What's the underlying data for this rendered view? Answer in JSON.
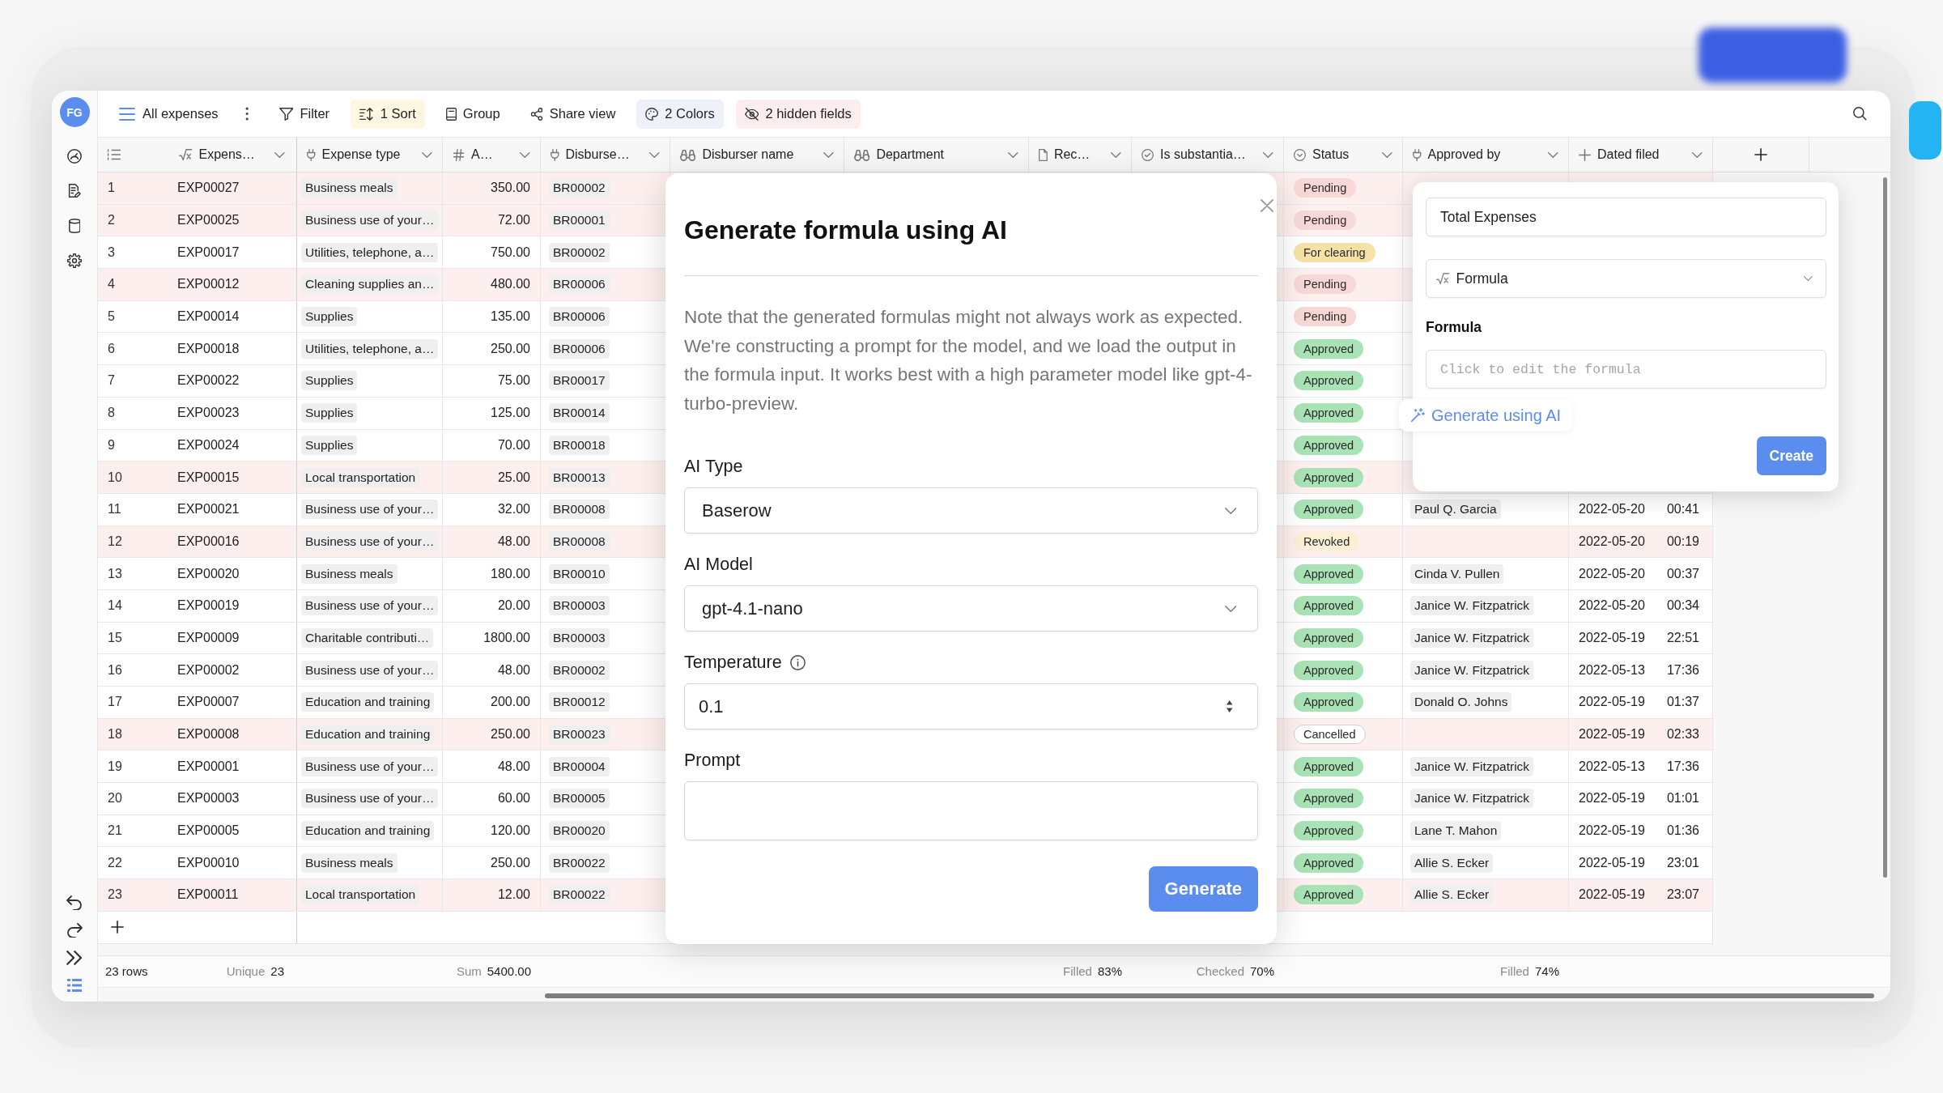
{
  "sidebar": {
    "avatar": "FG"
  },
  "toolbar": {
    "view_name": "All expenses",
    "items": [
      {
        "kind": "filter",
        "label": "Filter",
        "active": false
      },
      {
        "kind": "sort",
        "label": "1 Sort",
        "active": true
      },
      {
        "kind": "group",
        "label": "Group",
        "active": false
      },
      {
        "kind": "share",
        "label": "Share view",
        "active": false
      },
      {
        "kind": "colors",
        "label": "2 Colors",
        "active": true
      },
      {
        "kind": "hidden",
        "label": "2 hidden fields",
        "active": true
      }
    ]
  },
  "table": {
    "columns": [
      {
        "kind": "formula",
        "label": "Expens…",
        "footer": {
          "label": "Unique",
          "value": "23"
        }
      },
      {
        "kind": "link",
        "label": "Expense type"
      },
      {
        "kind": "number",
        "label": "A…",
        "footer": {
          "label": "Sum",
          "value": "5400.00"
        }
      },
      {
        "kind": "link",
        "label": "Disburse…"
      },
      {
        "kind": "lookup",
        "label": "Disburser name"
      },
      {
        "kind": "lookup",
        "label": "Department"
      },
      {
        "kind": "file",
        "label": "Rec…",
        "footer": {
          "label": "Filled",
          "value": "83%"
        }
      },
      {
        "kind": "boolean",
        "label": "Is substantia…",
        "footer": {
          "label": "Checked",
          "value": "70%"
        }
      },
      {
        "kind": "single_select",
        "label": "Status"
      },
      {
        "kind": "link",
        "label": "Approved by",
        "footer": {
          "label": "Filled",
          "value": "74%"
        }
      },
      {
        "kind": "created_on",
        "label": "Dated filed"
      }
    ],
    "rows": [
      {
        "count": "1",
        "expense": "EXP00027",
        "expense_type": "Business meals",
        "amount": "350.00",
        "disburser": "BR00002",
        "status": {
          "label": "Pending",
          "color": "#f8d8d6"
        },
        "highlighted": true
      },
      {
        "count": "2",
        "expense": "EXP00025",
        "expense_type": "Business use of your…",
        "amount": "72.00",
        "disburser": "BR00001",
        "status": {
          "label": "Pending",
          "color": "#f8d8d6"
        },
        "highlighted": true
      },
      {
        "count": "3",
        "expense": "EXP00017",
        "expense_type": "Utilities, telephone, a…",
        "amount": "750.00",
        "disburser": "BR00002",
        "status": {
          "label": "For clearing",
          "color": "#f6e2a6"
        },
        "highlighted": false
      },
      {
        "count": "4",
        "expense": "EXP00012",
        "expense_type": "Cleaning supplies an…",
        "amount": "480.00",
        "disburser": "BR00006",
        "status": {
          "label": "Pending",
          "color": "#f8d8d6"
        },
        "highlighted": true
      },
      {
        "count": "5",
        "expense": "EXP00014",
        "expense_type": "Supplies",
        "amount": "135.00",
        "disburser": "BR00006",
        "status": {
          "label": "Pending",
          "color": "#f8d8d6"
        },
        "highlighted": false
      },
      {
        "count": "6",
        "expense": "EXP00018",
        "expense_type": "Utilities, telephone, a…",
        "amount": "250.00",
        "disburser": "BR00006",
        "status": {
          "label": "Approved",
          "color": "#a9e2b5"
        },
        "highlighted": false
      },
      {
        "count": "7",
        "expense": "EXP00022",
        "expense_type": "Supplies",
        "amount": "75.00",
        "disburser": "BR00017",
        "status": {
          "label": "Approved",
          "color": "#a9e2b5"
        },
        "highlighted": false
      },
      {
        "count": "8",
        "expense": "EXP00023",
        "expense_type": "Supplies",
        "amount": "125.00",
        "disburser": "BR00014",
        "status": {
          "label": "Approved",
          "color": "#a9e2b5"
        },
        "highlighted": false
      },
      {
        "count": "9",
        "expense": "EXP00024",
        "expense_type": "Supplies",
        "amount": "70.00",
        "disburser": "BR00018",
        "status": {
          "label": "Approved",
          "color": "#a9e2b5"
        },
        "highlighted": false
      },
      {
        "count": "10",
        "expense": "EXP00015",
        "expense_type": "Local transportation",
        "amount": "25.00",
        "disburser": "BR00013",
        "status": {
          "label": "Approved",
          "color": "#a9e2b5"
        },
        "highlighted": true
      },
      {
        "count": "11",
        "expense": "EXP00021",
        "expense_type": "Business use of your…",
        "amount": "32.00",
        "disburser": "BR00008",
        "status": {
          "label": "Approved",
          "color": "#a9e2b5"
        },
        "approved_by": "Paul Q. Garcia",
        "dated_filed": {
          "date": "2022-05-20",
          "time": "00:41"
        },
        "highlighted": false
      },
      {
        "count": "12",
        "expense": "EXP00016",
        "expense_type": "Business use of your…",
        "amount": "48.00",
        "disburser": "BR00008",
        "status": {
          "label": "Revoked",
          "color": "#fbf0d6"
        },
        "dated_filed": {
          "date": "2022-05-20",
          "time": "00:19"
        },
        "highlighted": true
      },
      {
        "count": "13",
        "expense": "EXP00020",
        "expense_type": "Business meals",
        "amount": "180.00",
        "disburser": "BR00010",
        "status": {
          "label": "Approved",
          "color": "#a9e2b5"
        },
        "approved_by": "Cinda V. Pullen",
        "dated_filed": {
          "date": "2022-05-20",
          "time": "00:37"
        },
        "highlighted": false
      },
      {
        "count": "14",
        "expense": "EXP00019",
        "expense_type": "Business use of your…",
        "amount": "20.00",
        "disburser": "BR00003",
        "status": {
          "label": "Approved",
          "color": "#a9e2b5"
        },
        "approved_by": "Janice W. Fitzpatrick",
        "dated_filed": {
          "date": "2022-05-20",
          "time": "00:34"
        },
        "highlighted": false
      },
      {
        "count": "15",
        "expense": "EXP00009",
        "expense_type": "Charitable contributi…",
        "amount": "1800.00",
        "disburser": "BR00003",
        "status": {
          "label": "Approved",
          "color": "#a9e2b5"
        },
        "approved_by": "Janice W. Fitzpatrick",
        "dated_filed": {
          "date": "2022-05-19",
          "time": "22:51"
        },
        "highlighted": false
      },
      {
        "count": "16",
        "expense": "EXP00002",
        "expense_type": "Business use of your…",
        "amount": "48.00",
        "disburser": "BR00002",
        "status": {
          "label": "Approved",
          "color": "#a9e2b5"
        },
        "approved_by": "Janice W. Fitzpatrick",
        "dated_filed": {
          "date": "2022-05-13",
          "time": "17:36"
        },
        "highlighted": false
      },
      {
        "count": "17",
        "expense": "EXP00007",
        "expense_type": "Education and training",
        "amount": "200.00",
        "disburser": "BR00012",
        "status": {
          "label": "Approved",
          "color": "#a9e2b5"
        },
        "approved_by": "Donald O. Johns",
        "dated_filed": {
          "date": "2022-05-19",
          "time": "01:37"
        },
        "highlighted": false
      },
      {
        "count": "18",
        "expense": "EXP00008",
        "expense_type": "Education and training",
        "amount": "250.00",
        "disburser": "BR00023",
        "status": {
          "label": "Cancelled",
          "color": "#ffffff"
        },
        "dated_filed": {
          "date": "2022-05-19",
          "time": "02:33"
        },
        "highlighted": true
      },
      {
        "count": "19",
        "expense": "EXP00001",
        "expense_type": "Business use of your…",
        "amount": "48.00",
        "disburser": "BR00004",
        "status": {
          "label": "Approved",
          "color": "#a9e2b5"
        },
        "approved_by": "Janice W. Fitzpatrick",
        "dated_filed": {
          "date": "2022-05-13",
          "time": "17:36"
        },
        "highlighted": false
      },
      {
        "count": "20",
        "expense": "EXP00003",
        "expense_type": "Business use of your…",
        "amount": "60.00",
        "disburser": "BR00005",
        "status": {
          "label": "Approved",
          "color": "#a9e2b5"
        },
        "approved_by": "Janice W. Fitzpatrick",
        "dated_filed": {
          "date": "2022-05-19",
          "time": "01:01"
        },
        "highlighted": false
      },
      {
        "count": "21",
        "expense": "EXP00005",
        "expense_type": "Education and training",
        "amount": "120.00",
        "disburser": "BR00020",
        "status": {
          "label": "Approved",
          "color": "#a9e2b5"
        },
        "approved_by": "Lane T. Mahon",
        "dated_filed": {
          "date": "2022-05-19",
          "time": "01:36"
        },
        "highlighted": false
      },
      {
        "count": "22",
        "expense": "EXP00010",
        "expense_type": "Business meals",
        "amount": "250.00",
        "disburser": "BR00022",
        "status": {
          "label": "Approved",
          "color": "#a9e2b5"
        },
        "approved_by": "Allie S. Ecker",
        "dated_filed": {
          "date": "2022-05-19",
          "time": "23:01"
        },
        "highlighted": false
      },
      {
        "count": "23",
        "expense": "EXP00011",
        "expense_type": "Local transportation",
        "amount": "12.00",
        "disburser": "BR00022",
        "status": {
          "label": "Approved",
          "color": "#a9e2b5"
        },
        "approved_by": "Allie S. Ecker",
        "dated_filed": {
          "date": "2022-05-19",
          "time": "23:07"
        },
        "highlighted": true
      }
    ],
    "row_count": "23 rows"
  },
  "modal": {
    "title": "Generate formula using AI",
    "note": "Note that the generated formulas might not always work as expected. We're constructing a prompt for the model, and we load the output in the formula input. It works best with a high parameter model like gpt-4-turbo-preview.",
    "fields": [
      {
        "kind": "select",
        "label": "AI Type",
        "value": "Baserow",
        "info": false
      },
      {
        "kind": "select",
        "label": "AI Model",
        "value": "gpt-4.1-nano",
        "info": false
      },
      {
        "kind": "number",
        "label": "Temperature",
        "value": "0.1",
        "info": true
      },
      {
        "kind": "textarea",
        "label": "Prompt",
        "info": false
      }
    ],
    "submit": "Generate"
  },
  "field_form": {
    "name": {
      "value": "Total Expenses"
    },
    "type": {
      "value": "Formula"
    },
    "formula": {
      "label": "Formula",
      "placeholder": "Click to edit the formula"
    },
    "ai_link": "Generate using AI",
    "submit": "Create"
  }
}
